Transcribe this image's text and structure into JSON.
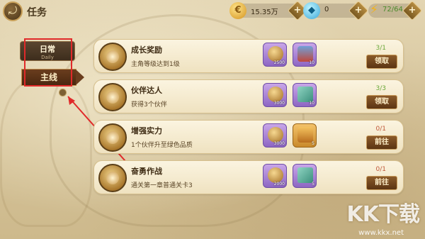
{
  "header": {
    "title": "任务",
    "back_icon": "back-arrow-icon",
    "resources": [
      {
        "name": "gold",
        "icon": "coin-icon",
        "value": "15.35万"
      },
      {
        "name": "diamond",
        "icon": "diamond-icon",
        "value": "0"
      },
      {
        "name": "energy",
        "icon": "lightning-icon",
        "value": "72/64"
      }
    ]
  },
  "tabs": {
    "daily": {
      "label": "日常",
      "sub": "Daily"
    },
    "main": {
      "label": "主线"
    }
  },
  "quests": [
    {
      "title": "成长奖励",
      "desc": "主角等级达到1级",
      "progress": "3/1",
      "action": "领取",
      "rewards": [
        {
          "type": "gold-bag",
          "qty": "2500"
        },
        {
          "type": "box",
          "qty": "10"
        }
      ]
    },
    {
      "title": "伙伴达人",
      "desc": "获得3个伙伴",
      "progress": "3/3",
      "action": "领取",
      "rewards": [
        {
          "type": "gold-bag",
          "qty": "3000"
        },
        {
          "type": "book",
          "qty": "10"
        }
      ]
    },
    {
      "title": "增强实力",
      "desc": "1个伙伴升至绿色品质",
      "progress": "0/1",
      "action": "前往",
      "rewards": [
        {
          "type": "gold-bag",
          "qty": "3000"
        },
        {
          "type": "chest",
          "qty": "5"
        }
      ]
    },
    {
      "title": "奋勇作战",
      "desc": "通关第一章普通关卡3",
      "progress": "0/1",
      "action": "前往",
      "rewards": [
        {
          "type": "gold-bag",
          "qty": "2000"
        },
        {
          "type": "book",
          "qty": "5"
        }
      ]
    }
  ],
  "watermark": {
    "logo": "KK下载",
    "url": "www.kkx.net"
  },
  "colors": {
    "accent": "#5b3513",
    "progress_done": "#6aa83a",
    "progress_todo": "#c0583a",
    "highlight": "#e02a2a"
  }
}
